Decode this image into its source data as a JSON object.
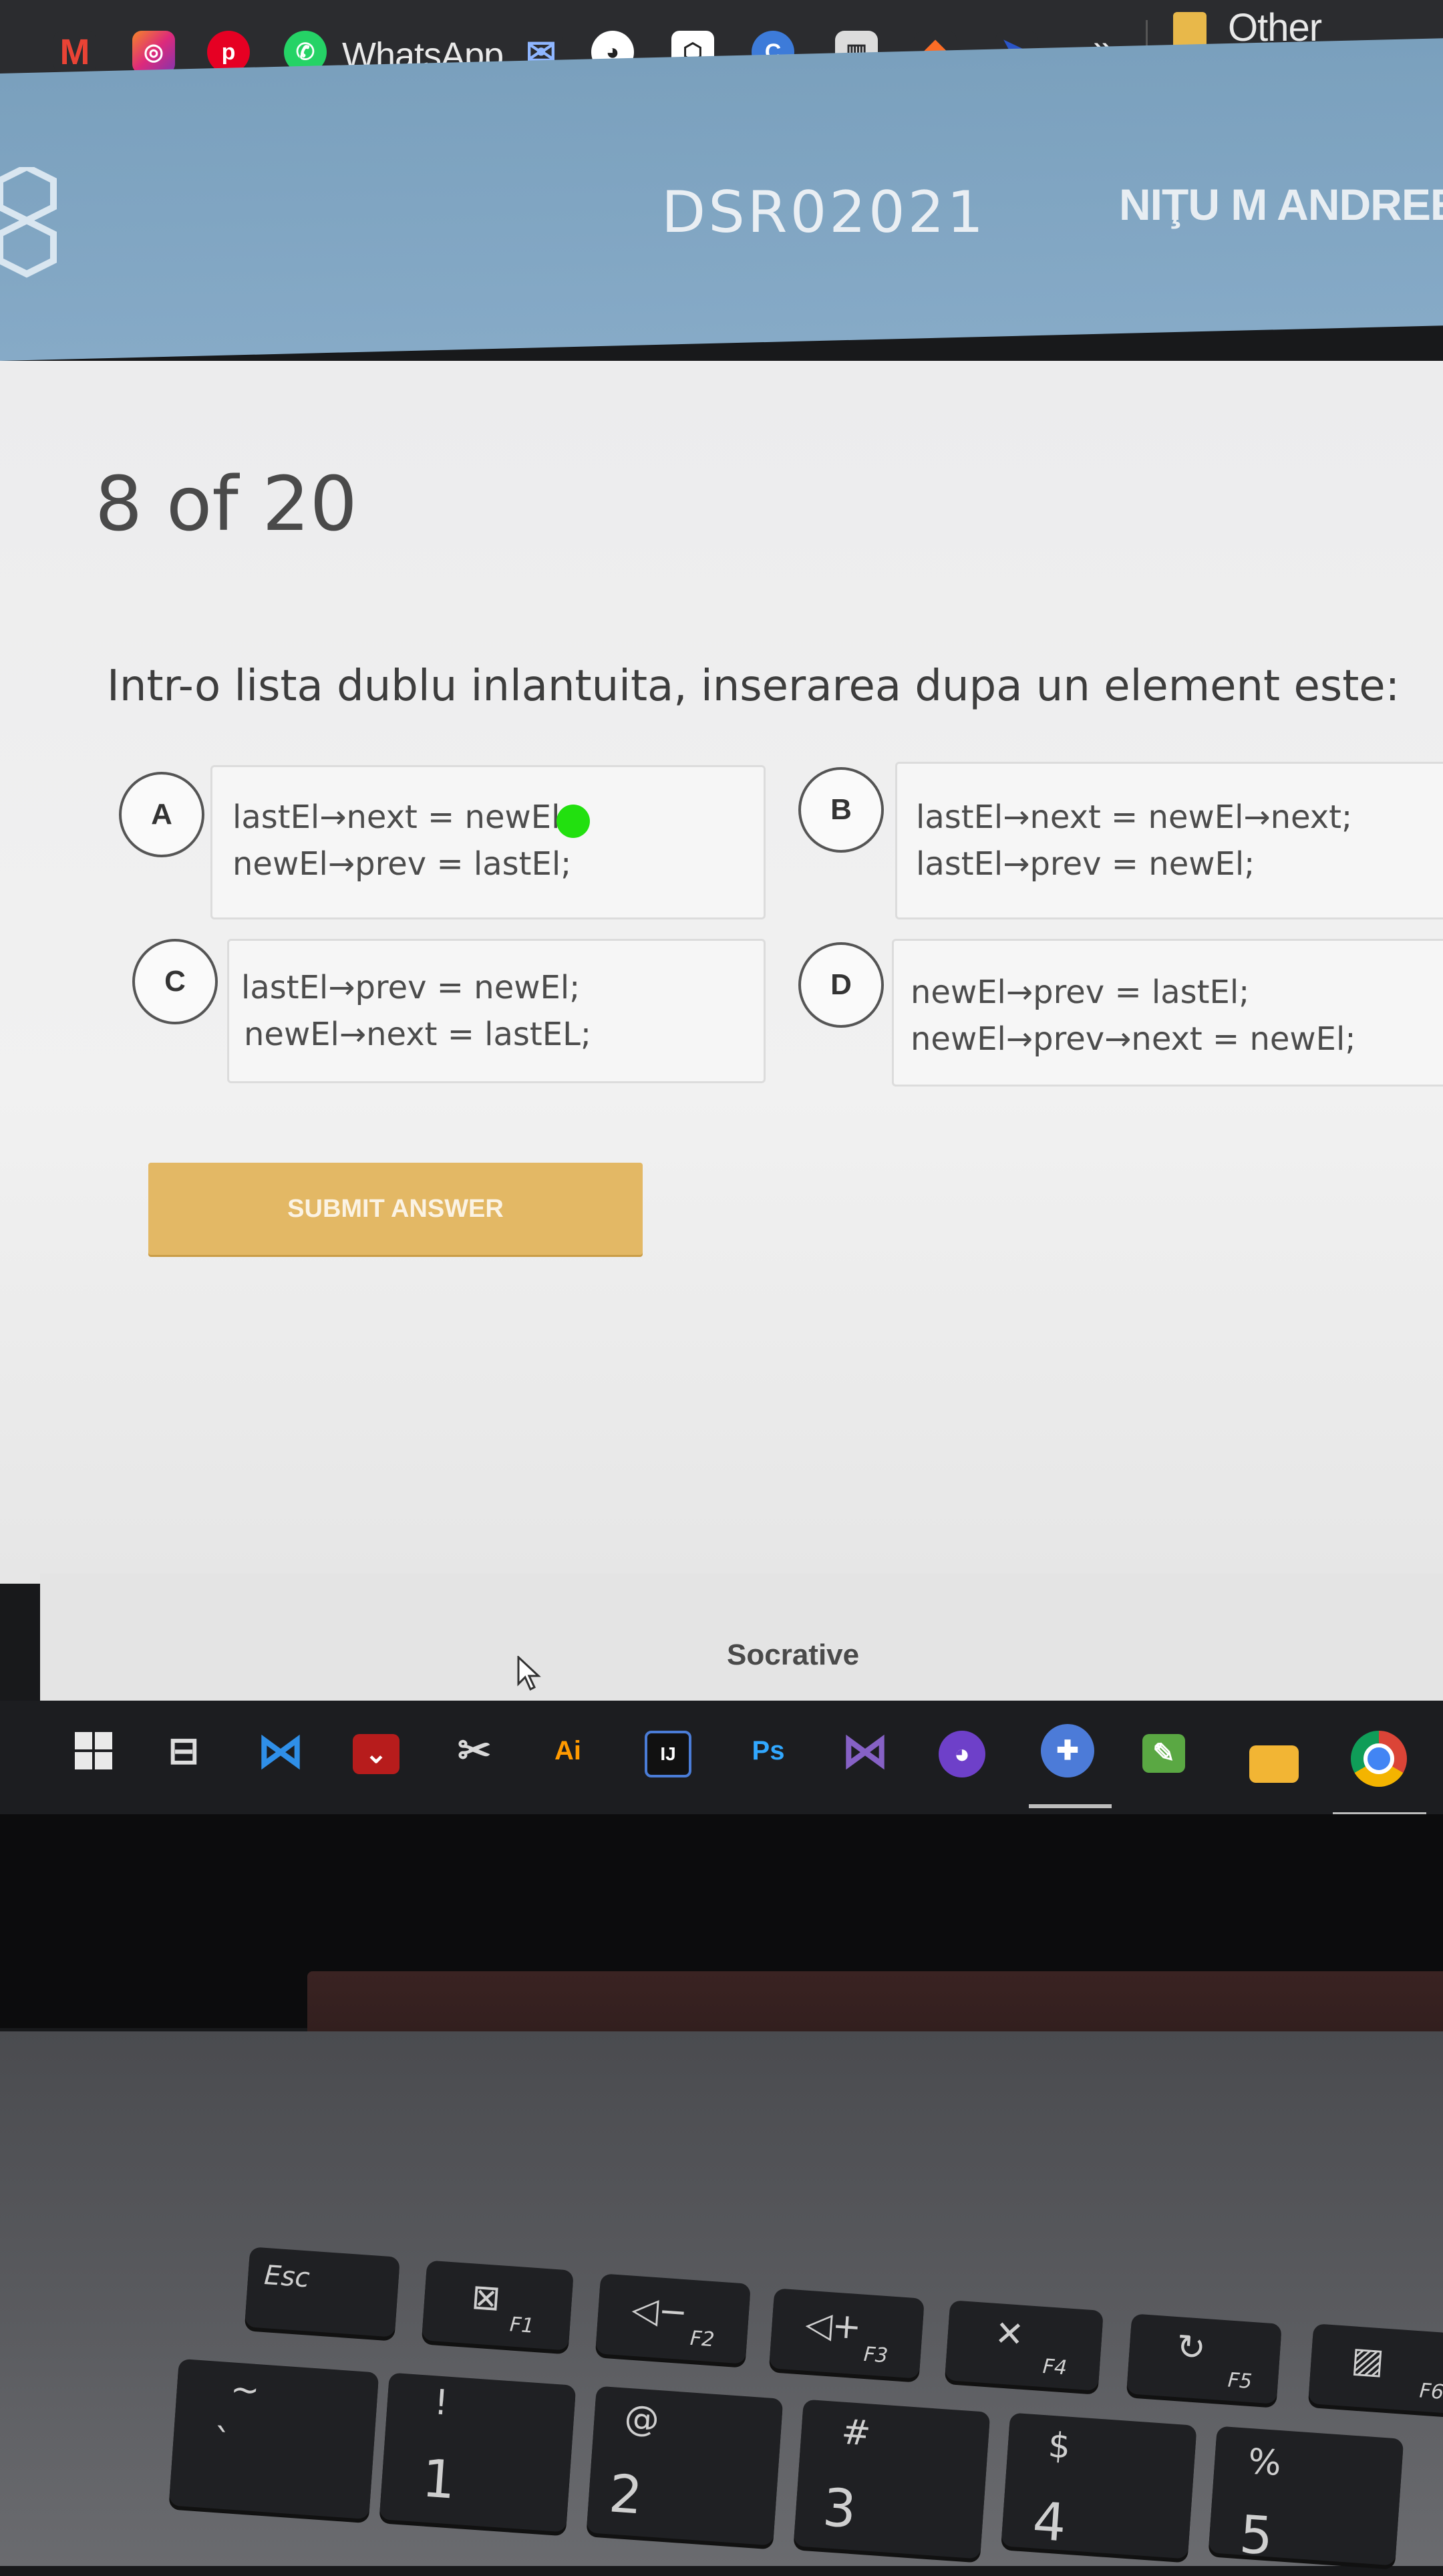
{
  "browser": {
    "bookmarks": {
      "whatsapp_label": "WhatsApp",
      "more_label": "»",
      "other_bookmarks_label": "Other bookmar",
      "icons": [
        "gmail-icon",
        "instagram-icon",
        "pinterest-icon",
        "whatsapp-icon",
        "mail-icon",
        "github-icon",
        "codepen-icon",
        "c-icon",
        "trello-icon",
        "gitlab-icon",
        "bird-icon"
      ]
    }
  },
  "header": {
    "course_code": "DSR02021",
    "student_name": "NIŢU M ANDREE"
  },
  "quiz": {
    "progress": "8 of 20",
    "question": "Intr-o lista dublu inlantuita, inserarea dupa un element este:",
    "options": [
      {
        "letter": "A",
        "line1": "lastEl→next = newEl;",
        "line2": "newEl→prev = lastEl;",
        "selected": true
      },
      {
        "letter": "B",
        "line1": "lastEl→next = newEl→next;",
        "line2": "lastEl→prev = newEl;",
        "selected": false
      },
      {
        "letter": "C",
        "line1": "lastEl→prev = newEl;",
        "line2": "newEl→next = lastEL;",
        "selected": false
      },
      {
        "letter": "D",
        "line1": "newEl→prev = lastEl;",
        "line2": "newEl→prev→next = newEl;",
        "selected": false
      }
    ],
    "submit_label": "SUBMIT ANSWER",
    "selected_marker_color": "#22e00f",
    "submit_color": "#e3b865"
  },
  "footer": {
    "brand": "Socrative"
  },
  "taskbar": {
    "ai_label": "Ai",
    "intellij_label": "IJ",
    "ps_label": "Ps",
    "icons": [
      "windows-start-icon",
      "task-view-icon",
      "vscode-icon",
      "mendeley-icon",
      "snipping-icon",
      "illustrator-icon",
      "intellij-icon",
      "photoshop-icon",
      "visual-studio-icon",
      "github-desktop-icon",
      "gamepad-icon",
      "notepad-icon",
      "file-explorer-icon",
      "chrome-icon"
    ]
  },
  "keyboard": {
    "esc": "Esc",
    "f1": "F1",
    "f2": "F2",
    "f3": "F3",
    "f4": "F4",
    "f5": "F5",
    "f6": "F6",
    "tilde": "~",
    "backtick": "`",
    "excl": "!",
    "one": "1",
    "at": "@",
    "two": "2",
    "hash": "#",
    "three": "3",
    "dollar": "$",
    "four": "4",
    "percent": "%",
    "five": "5"
  }
}
